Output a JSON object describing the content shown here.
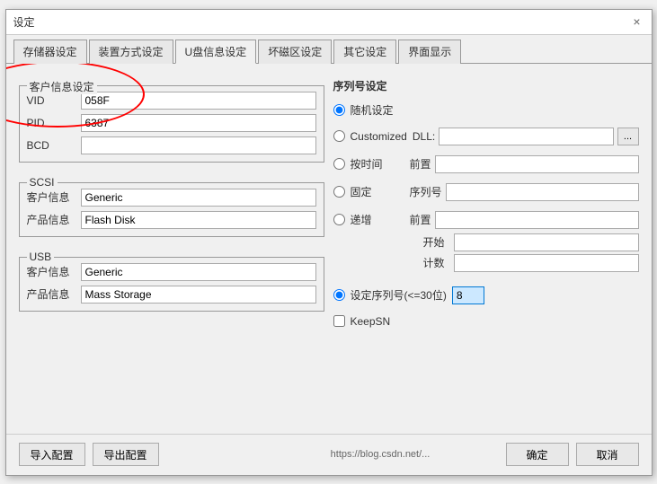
{
  "window": {
    "title": "设定",
    "close_label": "×"
  },
  "tabs": [
    {
      "label": "存储器设定",
      "active": false
    },
    {
      "label": "装置方式设定",
      "active": false
    },
    {
      "label": "U盘信息设定",
      "active": true
    },
    {
      "label": "坏磁区设定",
      "active": false
    },
    {
      "label": "其它设定",
      "active": false
    },
    {
      "label": "界面显示",
      "active": false
    }
  ],
  "left": {
    "client_section_title": "客户信息设定",
    "vid_label": "VID",
    "vid_value": "058F",
    "pid_label": "PID",
    "pid_value": "6387",
    "bcd_label": "BCD",
    "bcd_value": "",
    "scsi_section_title": "SCSI",
    "scsi_client_label": "客户信息",
    "scsi_client_value": "Generic",
    "scsi_product_label": "产品信息",
    "scsi_product_value": "Flash Disk",
    "usb_section_title": "USB",
    "usb_client_label": "客户信息",
    "usb_client_value": "Generic",
    "usb_product_label": "产品信息",
    "usb_product_value": "Mass Storage"
  },
  "right": {
    "serial_section_title": "序列号设定",
    "random_label": "随机设定",
    "customized_label": "Customized",
    "dll_label": "DLL:",
    "dll_value": "",
    "dll_btn_label": "...",
    "time_label": "按时间",
    "time_prefix_label": "前置",
    "time_prefix_value": "",
    "fixed_label": "固定",
    "fixed_serial_label": "序列号",
    "fixed_serial_value": "",
    "increment_label": "递增",
    "increment_prefix_label": "前置",
    "increment_prefix_value": "",
    "increment_start_label": "开始",
    "increment_start_value": "",
    "increment_count_label": "计数",
    "increment_count_value": "",
    "set_serial_label": "设定序列号(<=30位)",
    "set_serial_value": "8",
    "keepsn_label": "KeepSN",
    "random_selected": true,
    "set_serial_selected": true,
    "keepsn_checked": false
  },
  "footer": {
    "import_label": "导入配置",
    "export_label": "导出配置",
    "url_text": "https://blog.csdn.net/...",
    "ok_label": "确定",
    "cancel_label": "取消"
  }
}
